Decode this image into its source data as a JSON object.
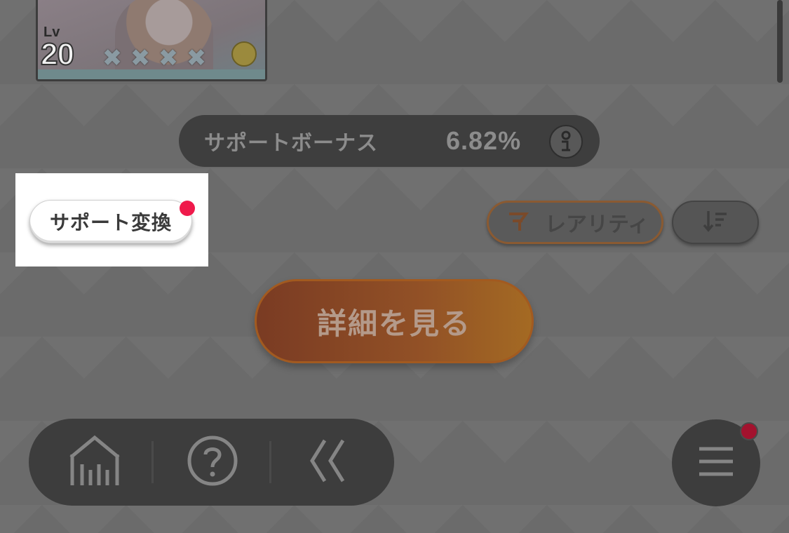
{
  "card": {
    "level_label": "Lv",
    "level_value": "20",
    "stars": [
      "✖",
      "✖",
      "✖",
      "✖"
    ],
    "badge_icon": "support-badge-icon"
  },
  "bonus": {
    "label": "サポートボーナス",
    "value": "6.82%"
  },
  "convert": {
    "label": "サポート変換",
    "notification": true
  },
  "filters": {
    "rarity_label": "レアリティ",
    "rarity_icon": "rarity-filter-icon",
    "sort_icon": "sort-descending-icon"
  },
  "details": {
    "label": "詳細を見る"
  },
  "nav": {
    "home_icon": "home-icon",
    "help_icon": "help-icon",
    "back_icon": "back-icon",
    "menu_icon": "menu-icon",
    "menu_notification": true
  },
  "colors": {
    "notification_red": "#ef1a4b",
    "accent_orange": "#a46a23"
  }
}
